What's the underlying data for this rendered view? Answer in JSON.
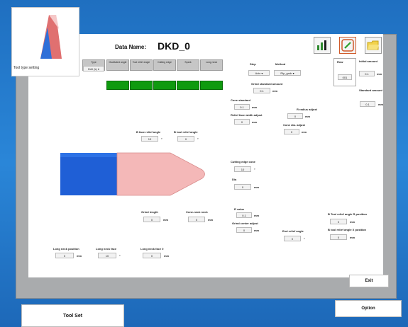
{
  "thumbnail": {
    "label": "Tool type setting"
  },
  "header": {
    "data_name_label": "Data Name:",
    "data_name_value": "DKD_0"
  },
  "type_table": {
    "headers": [
      "Type",
      "Oscillated angle",
      "Tool relief angle",
      "Cutting edge",
      "Spark",
      "Long neck"
    ],
    "type_select": "Drill (k) ▾",
    "green_values": [
      "",
      "",
      "",
      "",
      ""
    ]
  },
  "step": {
    "label": "Step",
    "value": "Arbr ▾"
  },
  "method": {
    "label": "Method",
    "value": "Rip_gndr ▾"
  },
  "row_box": {
    "label": "Row",
    "value": "001"
  },
  "initial_amount": {
    "label": "Initial amount",
    "value": "0.1"
  },
  "grind_std_amount": {
    "label": "Grind standard amount",
    "value": "0.1",
    "unit": "mm"
  },
  "standard_amount": {
    "label": "Standard amount",
    "value": "0.1",
    "unit": "mm"
  },
  "cone_standard": {
    "label": "Cone standard",
    "value": "0.1",
    "unit": "mm"
  },
  "relief_face_width": {
    "label": "Relief face width adjust",
    "value": "0",
    "unit": "mm"
  },
  "r_radius_adjust": {
    "label": "R radius adjust",
    "value": "0",
    "unit": "mm"
  },
  "cone_dia_adjust": {
    "label": "Cone dia. adjust",
    "value": "0",
    "unit": "mm"
  },
  "b_face_relief": {
    "label": "B face relief angle",
    "value": "10",
    "unit": "°"
  },
  "b_tool_relief": {
    "label": "B tool relief angle",
    "value": "0",
    "unit": "°"
  },
  "cutting_edge_cone": {
    "label": "Cutting edge cone",
    "value": "10",
    "unit": "°"
  },
  "dia": {
    "label": "Dia",
    "value": "0",
    "unit": "mm"
  },
  "grind_length": {
    "label": "Grind length",
    "value": "0",
    "unit": "mm"
  },
  "cone_neck": {
    "label": "Cone-neck neck",
    "value": "0",
    "unit": "mm"
  },
  "r_value": {
    "label": "R value",
    "value": "0.1",
    "unit": "mm"
  },
  "grind_center_adjust": {
    "label": "Grind center adjust",
    "value": "0",
    "unit": "mm"
  },
  "end_relief_angle": {
    "label": "End relief angle",
    "value": "0",
    "unit": "°"
  },
  "b_tool_r_position": {
    "label": "B Tool relief angle R position",
    "value": "0",
    "unit": "mm"
  },
  "b_tool_x_position": {
    "label": "B tool relief angle X position",
    "value": "0",
    "unit": "mm"
  },
  "long_neck_position": {
    "label": "Long neck position",
    "value": "0",
    "unit": "mm"
  },
  "long_neck_face": {
    "label": "Long neck face",
    "value": "10",
    "unit": "°"
  },
  "long_neck_face_b": {
    "label": "Long neck face 0",
    "value": "0",
    "unit": "mm"
  },
  "buttons": {
    "exit": "Exit",
    "options": "Option",
    "tool_set": "Tool Set"
  },
  "colors": {
    "background": "#2a86d8",
    "tool_shank": "#1f5fd6",
    "tool_tip": "#f4b8b8",
    "status_green": "#0f9a0f"
  }
}
